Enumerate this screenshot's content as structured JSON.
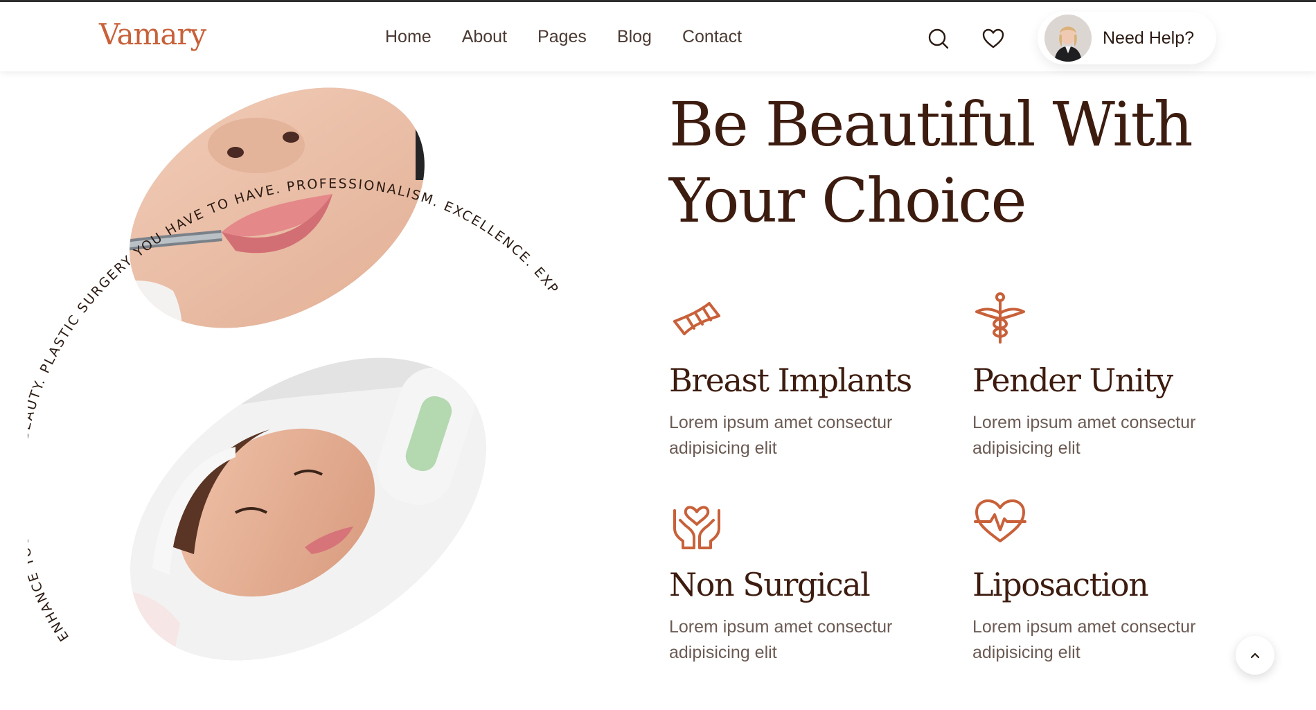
{
  "brand": {
    "logo": "Vamary",
    "accent": "#c8613a",
    "heading_color": "#3d1c10"
  },
  "nav": {
    "items": [
      {
        "label": "Home"
      },
      {
        "label": "About"
      },
      {
        "label": "Pages"
      },
      {
        "label": "Blog"
      },
      {
        "label": "Contact"
      }
    ]
  },
  "header": {
    "search_icon": "search-icon",
    "wishlist_icon": "heart-icon",
    "help_label": "Need Help?"
  },
  "hero": {
    "title": "Be Beautiful With Your Choice",
    "circular_text": "ENHANCE YOUR NATURAL BEAUTY. PLASTIC SURGERY YOU HAVE TO HAVE. PROFESSIONALISM. EXCELLENCE. EXPERIENCE. EXPERIENCE A MORE BEAUTIFUL YOU."
  },
  "features": [
    {
      "icon": "dna-icon",
      "title": "Breast Implants",
      "text": "Lorem ipsum amet consectur adipisicing elit"
    },
    {
      "icon": "caduceus-icon",
      "title": "Pender Unity",
      "text": "Lorem ipsum amet consectur adipisicing elit"
    },
    {
      "icon": "hands-heart-icon",
      "title": "Non Surgical",
      "text": "Lorem ipsum amet consectur adipisicing elit"
    },
    {
      "icon": "heartbeat-icon",
      "title": "Liposaction",
      "text": "Lorem ipsum amet consectur adipisicing elit"
    }
  ],
  "scroll_top_icon": "chevron-up-icon"
}
